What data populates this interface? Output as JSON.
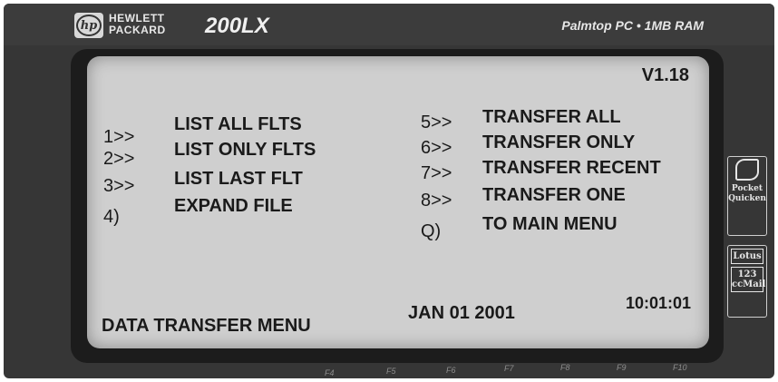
{
  "device": {
    "brand_line1": "HEWLETT",
    "brand_line2": "PACKARD",
    "logo_text": "hp",
    "model": "200LX",
    "spec": "Palmtop PC • 1MB RAM",
    "side_apps": {
      "pocket_quicken_line1": "Pocket",
      "pocket_quicken_line2": "Quicken",
      "lotus_label": "Lotus",
      "lotus_123": "123",
      "ccmail": "ccMail"
    },
    "function_keys": [
      "F4",
      "F5",
      "F6",
      "F7",
      "F8",
      "F9",
      "F10"
    ]
  },
  "screen": {
    "version": "V1.18",
    "menu_left": [
      {
        "key": "1>>",
        "label": "LIST ALL FLTS"
      },
      {
        "key": "2>>",
        "label": "LIST ONLY FLTS"
      },
      {
        "key": "3>>",
        "label": "LIST LAST FLT"
      },
      {
        "key": "4)",
        "label": "EXPAND FILE"
      }
    ],
    "menu_right": [
      {
        "key": "5>>",
        "label": "TRANSFER ALL"
      },
      {
        "key": "6>>",
        "label": "TRANSFER ONLY"
      },
      {
        "key": "7>>",
        "label": "TRANSFER RECENT"
      },
      {
        "key": "8>>",
        "label": "TRANSFER ONE"
      },
      {
        "key": "Q)",
        "label": "TO MAIN MENU"
      }
    ],
    "footer_title": "DATA TRANSFER MENU",
    "date": "JAN 01 2001",
    "time": "10:01:01"
  }
}
